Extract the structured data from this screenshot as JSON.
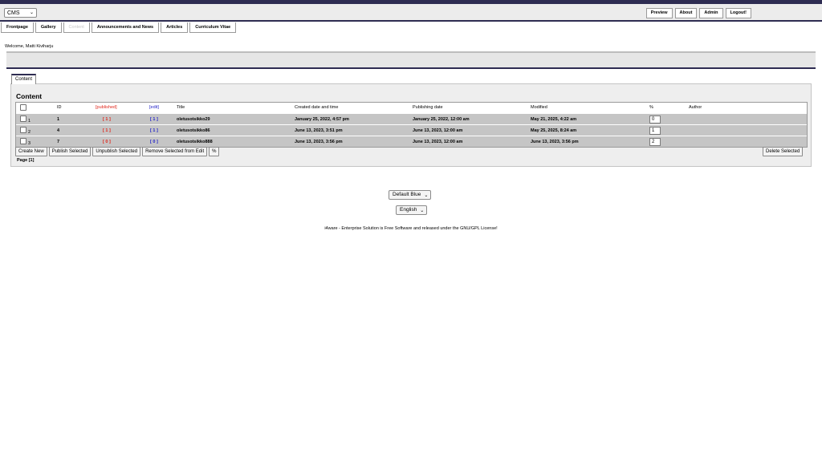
{
  "app": {
    "module_select": "CMS",
    "top_buttons": [
      "Preview",
      "About",
      "Admin",
      "Logout!"
    ],
    "tabs": [
      "Frontpage",
      "Gallery",
      "Content",
      "Announcements and News",
      "Articles",
      "Curriculum Vitae"
    ],
    "welcome": "Welcome, Matti Kiviharju"
  },
  "content": {
    "tab_label": "Content",
    "title": "Content",
    "columns": [
      "ID",
      "[published]",
      "[edit]",
      "Title",
      "Created date and time",
      "Publishing date",
      "Modified",
      "%",
      "Author"
    ],
    "rows": [
      {
        "num": "1",
        "id": "1",
        "published": "[ 1 ]",
        "edit": "[ 1 ]",
        "title": "oletusotsikko29",
        "created": "January 25, 2022, 4:57 pm",
        "publishing": "January 25, 2022, 12:00 am",
        "modified": "May 21, 2025, 4:22 am",
        "pct": "0",
        "author": ""
      },
      {
        "num": "2",
        "id": "4",
        "published": "[ 1 ]",
        "edit": "[ 1 ]",
        "title": "oletusotsikko86",
        "created": "June 13, 2023, 3:51 pm",
        "publishing": "June 13, 2023, 12:00 am",
        "modified": "May 25, 2025, 8:24 am",
        "pct": "1",
        "author": ""
      },
      {
        "num": "3",
        "id": "7",
        "published": "[ 0 ]",
        "edit": "[ 0 ]",
        "title": "oletusotsikko888",
        "created": "June 13, 2023, 3:56 pm",
        "publishing": "June 13, 2023, 12:00 am",
        "modified": "June 13, 2023, 3:56 pm",
        "pct": "2",
        "author": ""
      }
    ],
    "actions": [
      "Create New",
      "Publish Selected",
      "Unpublish Selected",
      "Remove Selected from Edit",
      "%"
    ],
    "delete_label": "Delete Selected",
    "page": "Page [1]"
  },
  "footer": {
    "theme": "Default Blue",
    "language": "English",
    "license": "i4ware - Enterprise Solution is Free Software and released under the GNU/GPL License!"
  },
  "colors": {
    "accent": "#2e2c52",
    "published": "#e0271c",
    "edit": "#2323c8",
    "row_bg": "#c5c5c5"
  }
}
